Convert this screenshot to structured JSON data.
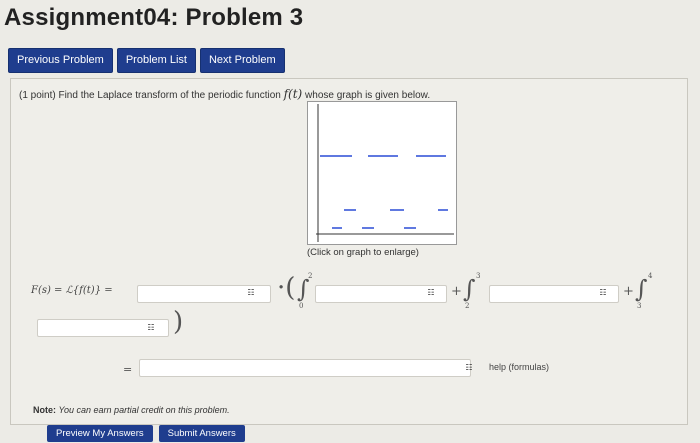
{
  "page": {
    "title": "Assignment04: Problem 3"
  },
  "nav": {
    "previous": "Previous Problem",
    "list": "Problem List",
    "next": "Next Problem"
  },
  "problem": {
    "points": "(1 point)",
    "text": "Find the Laplace transform of the periodic function",
    "func": "f(t)",
    "text_after": "whose graph is given below.",
    "caption": "(Click on graph to enlarge)"
  },
  "equation": {
    "lhs": "F(s) = ℒ{f(t)} =",
    "dot_paren": "·(",
    "close_paren": ")",
    "plus": "+",
    "equals": "=",
    "int1_lower": "0",
    "int1_upper": "2",
    "int2_lower": "2",
    "int2_upper": "3",
    "int3_lower": "3",
    "int3_upper": "4"
  },
  "help": "help (formulas)",
  "note": {
    "label": "Note:",
    "text": "You can earn partial credit on this problem."
  },
  "actions": {
    "preview": "Preview My Answers",
    "submit": "Submit Answers"
  },
  "icons": {
    "input_helper": "grid-icon"
  }
}
